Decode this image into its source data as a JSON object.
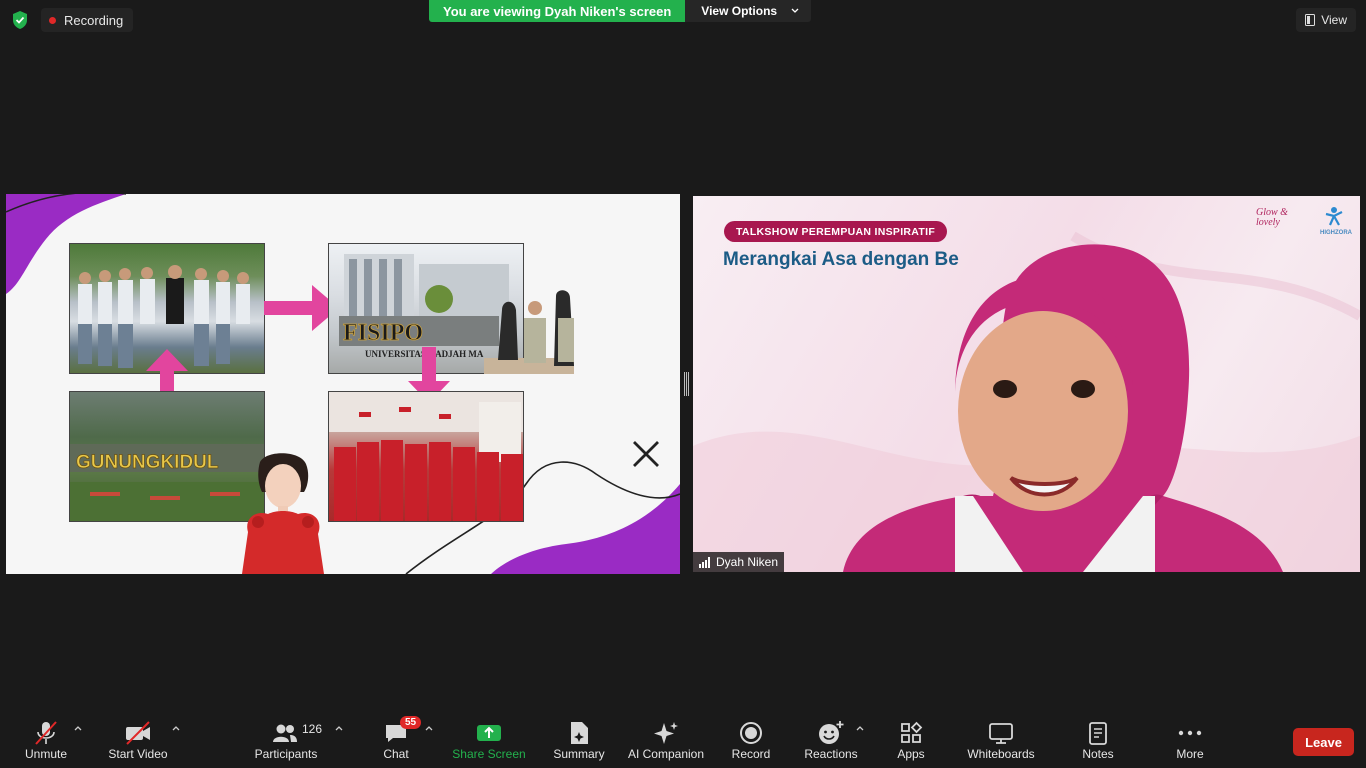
{
  "top_bar": {
    "recording_label": "Recording",
    "viewing_text": "You are viewing Dyah Niken's screen",
    "view_options_label": "View Options",
    "view_label": "View"
  },
  "shared_slide": {
    "photo_labels": {
      "faculty_sign": "FISIPO",
      "university_text": "UNIVERSITAS GADJAH MA",
      "regency_sign": "GUNUNGKIDUL"
    }
  },
  "speaker_video": {
    "talk_badge": "TALKSHOW PEREMPUAN INSPIRATIF",
    "talk_title": "Merangkai Asa dengan Be",
    "brand_logo_1": "Glow & lovely",
    "brand_logo_2": "HIGHZORA",
    "participant_name": "Dyah Niken"
  },
  "toolbar": {
    "unmute": "Unmute",
    "start_video": "Start Video",
    "participants": "Participants",
    "participant_count": "126",
    "chat": "Chat",
    "chat_badge": "55",
    "share_screen": "Share Screen",
    "summary": "Summary",
    "ai_companion": "AI Companion",
    "record": "Record",
    "reactions": "Reactions",
    "apps": "Apps",
    "whiteboards": "Whiteboards",
    "notes": "Notes",
    "more": "More",
    "leave": "Leave"
  },
  "colors": {
    "share_green": "#23b14d",
    "leave_red": "#c8261e",
    "arrow_pink": "#e2459e",
    "slide_purple": "#9a2bc4"
  }
}
